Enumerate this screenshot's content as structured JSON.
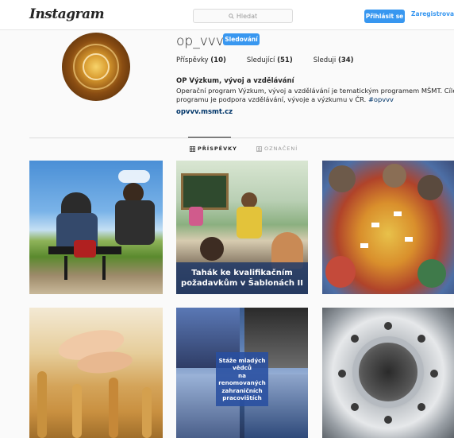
{
  "header": {
    "logo": "Instagram",
    "search_placeholder": "Hledat",
    "login_label": "Přihlásit se",
    "register_label": "Zaregistrovat se"
  },
  "profile": {
    "username": "op_vvv",
    "follow_label": "Sledování",
    "stats": {
      "posts_label": "Příspěvky",
      "posts_count": "(10)",
      "followers_label": "Sledující",
      "followers_count": "(51)",
      "following_label": "Sleduji",
      "following_count": "(34)"
    },
    "full_name": "OP Výzkum, vývoj a vzdělávání",
    "bio_line1": "Operační program Výzkum, vývoj a vzdělávání je tematickým programem MŠMT. Cílem",
    "bio_line2": "programu je podpora vzdělávání, vývoje a výzkumu v ČR.",
    "bio_hashtag": "#opvvv",
    "website": "opvvv.msmt.cz"
  },
  "tabs": {
    "posts": "PŘÍSPĚVKY",
    "tagged": "OZNAČENÍ"
  },
  "posts": {
    "p2_line1": "Tahák ke kvalifikačním",
    "p2_line2": "požadavkům v Šablonách II",
    "p5_line1": "Stáže mladých",
    "p5_line2": "vědců",
    "p5_line3": "na renomovaných",
    "p5_line4": "zahraničních",
    "p5_line5": "pracovištích"
  },
  "colors": {
    "accent": "#3897f0",
    "link": "#003569"
  }
}
